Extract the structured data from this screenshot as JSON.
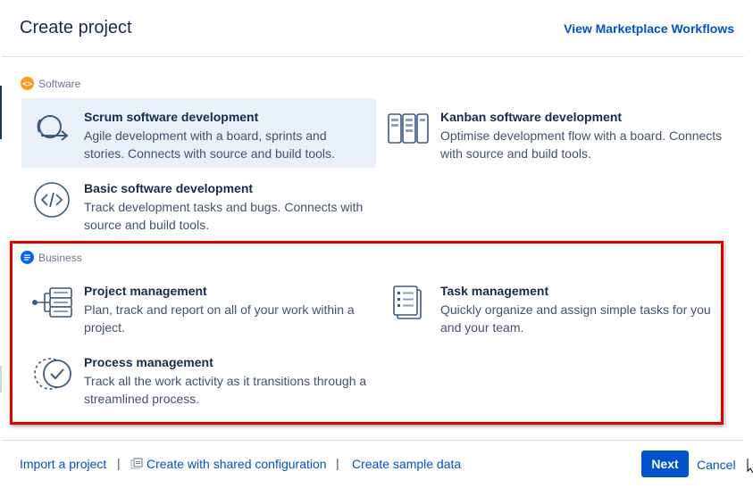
{
  "dialog": {
    "title": "Create project",
    "marketplace_link": "View Marketplace Workflows"
  },
  "sections": {
    "software": {
      "label": "Software",
      "icon_glyph": "<>",
      "icon_color": "#ff991f",
      "templates": [
        {
          "name": "Scrum software development",
          "description": "Agile development with a board, sprints and stories. Connects with source and build tools.",
          "icon": "scrum-icon",
          "selected": true
        },
        {
          "name": "Kanban software development",
          "description": "Optimise development flow with a board. Connects with source and build tools.",
          "icon": "kanban-icon",
          "selected": false
        },
        {
          "name": "Basic software development",
          "description": "Track development tasks and bugs. Connects with source and build tools.",
          "icon": "code-icon",
          "selected": false
        }
      ]
    },
    "business": {
      "label": "Business",
      "icon_color": "#0065ff",
      "templates": [
        {
          "name": "Project management",
          "description": "Plan, track and report on all of your work within a project.",
          "icon": "project-management-icon"
        },
        {
          "name": "Task management",
          "description": "Quickly organize and assign simple tasks for you and your team.",
          "icon": "task-list-icon"
        },
        {
          "name": "Process management",
          "description": "Track all the work activity as it transitions through a streamlined process.",
          "icon": "process-check-icon"
        }
      ]
    }
  },
  "footer": {
    "import_link": "Import a project",
    "separator": "|",
    "shared_config_link": "Create with shared configuration",
    "sample_data_link": "Create sample data",
    "next_button": "Next",
    "cancel_link": "Cancel"
  },
  "colors": {
    "primary": "#0052cc",
    "selected_background": "#e9f0fa",
    "highlight_border": "#e00000"
  }
}
